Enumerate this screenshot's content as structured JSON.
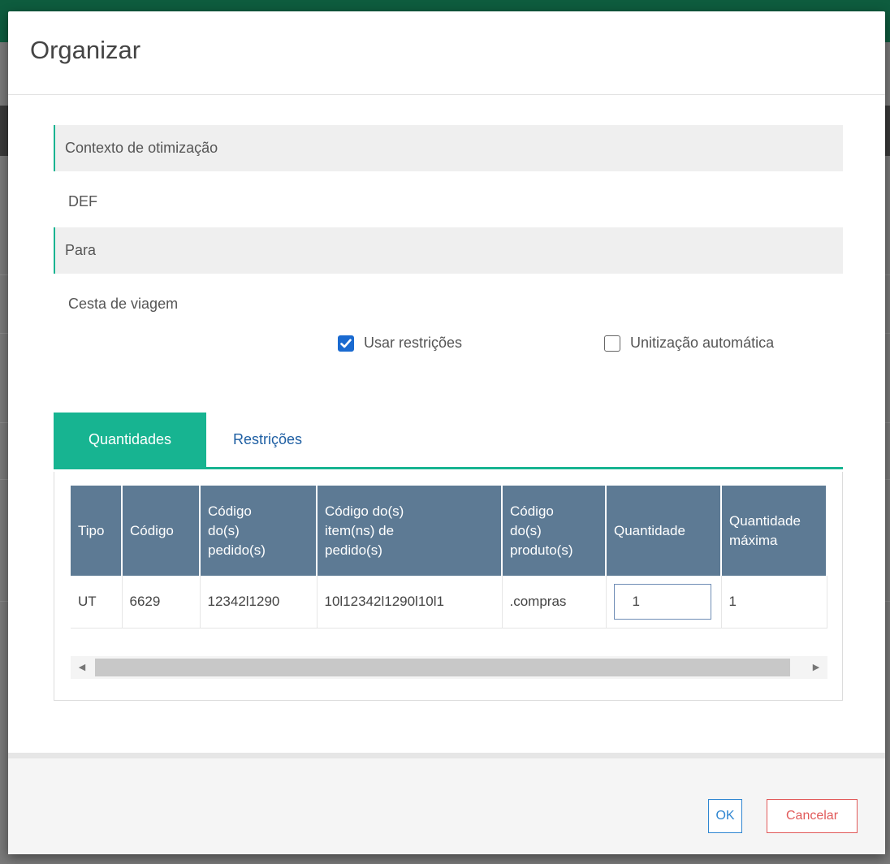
{
  "modal": {
    "title": "Organizar",
    "context_label": "Contexto de otimização",
    "context_value": "DEF",
    "for_label": "Para",
    "for_value": "Cesta de viagem",
    "use_restrictions": {
      "label": "Usar restrições",
      "checked": true
    },
    "auto_unitization": {
      "label": "Unitização automática",
      "checked": false
    },
    "tabs": [
      {
        "label": "Quantidades",
        "active": true
      },
      {
        "label": "Restrições",
        "active": false
      }
    ],
    "table": {
      "headers": [
        [
          "Tipo"
        ],
        [
          "Código"
        ],
        [
          "Código",
          "do(s)",
          "pedido(s)"
        ],
        [
          "Código do(s)",
          "item(ns) de",
          "pedido(s)"
        ],
        [
          "Código",
          "do(s)",
          "produto(s)"
        ],
        [
          "Quantidade"
        ],
        [
          "Quantidade",
          "máxima"
        ]
      ],
      "rows": [
        {
          "tipo": "UT",
          "codigo": "6629",
          "pedidos": "12342l1290",
          "itens": "10l12342l1290l10l1",
          "produtos": ".compras",
          "quantidade": "1",
          "maxima": "1"
        }
      ]
    },
    "buttons": {
      "ok": "OK",
      "cancel": "Cancelar"
    },
    "colors": {
      "accent": "#17b491",
      "header_bg": "#5d7a94",
      "primary": "#1a6ad0",
      "danger": "#e15a5a"
    }
  }
}
